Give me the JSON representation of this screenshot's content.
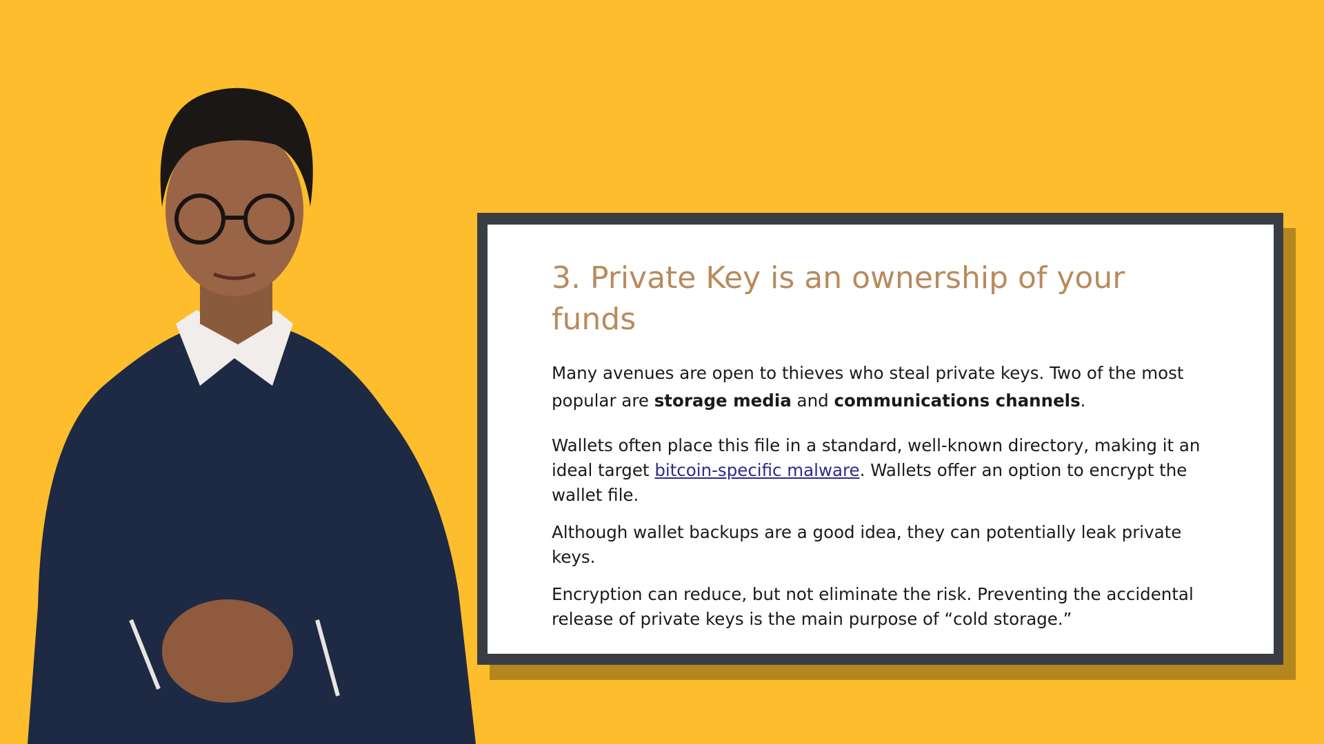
{
  "colors": {
    "background": "#FDBD2C",
    "frame": "#3A3E44",
    "title": "#B98A5C",
    "body_text": "#1A1A1A",
    "link": "#2B2B8C",
    "shirt": "#1E2A44"
  },
  "presenter": {
    "icon": "presenter-figure"
  },
  "slide": {
    "title": "3. Private Key is an ownership of your funds",
    "paragraph1": {
      "part1": "Many avenues are open to thieves who steal private keys. Two of the most popular are ",
      "bold1": "storage media",
      "part2": " and ",
      "bold2": "communications channels",
      "part3": "."
    },
    "paragraph2": {
      "part1": "Wallets often place this file in a standard, well-known directory, making it an ideal target ",
      "link": "bitcoin-specific malware",
      "part2": ". Wallets offer an option to encrypt the wallet file."
    },
    "paragraph3": "Although wallet backups are a good idea, they can potentially leak private keys.",
    "paragraph4": "Encryption can reduce, but not eliminate the risk. Preventing the accidental release of private keys is the main purpose of “cold storage.”"
  }
}
